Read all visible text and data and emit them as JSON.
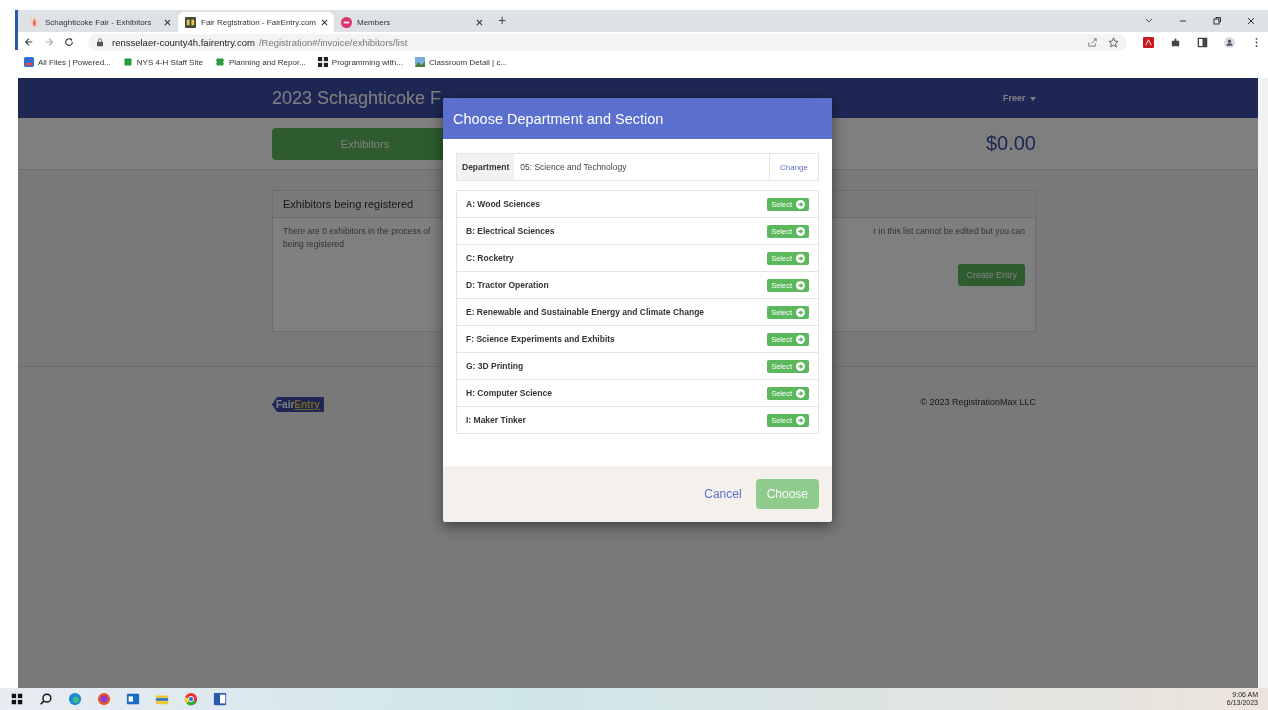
{
  "browser": {
    "tabs": [
      {
        "title": "Schaghticoke Fair - Exhibitors",
        "selected": false
      },
      {
        "title": "Fair Registration - FairEntry.com",
        "selected": true
      },
      {
        "title": "Members",
        "selected": false
      }
    ],
    "new_tab": "+",
    "url_host": "rensselaer-county4h.fairentry.com",
    "url_path": "/Registration#/invoice/exhibitors/list",
    "bookmarks": [
      {
        "label": "All Files | Powered..."
      },
      {
        "label": "NYS 4-H Staff Site"
      },
      {
        "label": "Planning and Repor..."
      },
      {
        "label": "Programming with..."
      },
      {
        "label": "Classroom Detail | c..."
      }
    ]
  },
  "page": {
    "title": "2023 Schaghticoke F",
    "user_menu": "Freer",
    "exhibitors_button": "Exhibitors",
    "total": "$0.00",
    "panel_title": "Exhibitors being registered",
    "panel_text_left": "There are 0 exhibitors in the process of",
    "panel_text_left_2": "being registered",
    "panel_text_right": "r in this list cannot be edited but you can",
    "create_button": "Create Entry",
    "footer_logo_a": "Fair",
    "footer_logo_b": "Entry",
    "copyright": "© 2023 RegistrationMax LLC"
  },
  "modal": {
    "title": "Choose Department and Section",
    "department_label": "Department",
    "department_value": "05: Science and Technology",
    "change_link": "Change",
    "sections": [
      {
        "name": "A: Wood Sciences",
        "button": "Select"
      },
      {
        "name": "B: Electrical Sciences",
        "button": "Select"
      },
      {
        "name": "C: Rocketry",
        "button": "Select"
      },
      {
        "name": "D: Tractor Operation",
        "button": "Select"
      },
      {
        "name": "E: Renewable and Sustainable Energy and Climate Change",
        "button": "Select"
      },
      {
        "name": "F: Science Experiments and Exhibits",
        "button": "Select"
      },
      {
        "name": "G: 3D Printing",
        "button": "Select"
      },
      {
        "name": "H: Computer Science",
        "button": "Select"
      },
      {
        "name": "I: Maker Tinker",
        "button": "Select"
      }
    ],
    "cancel": "Cancel",
    "choose": "Choose",
    "choose_disabled": true
  },
  "taskbar": {
    "time": "9:06 AM",
    "date": "6/13/2023"
  }
}
